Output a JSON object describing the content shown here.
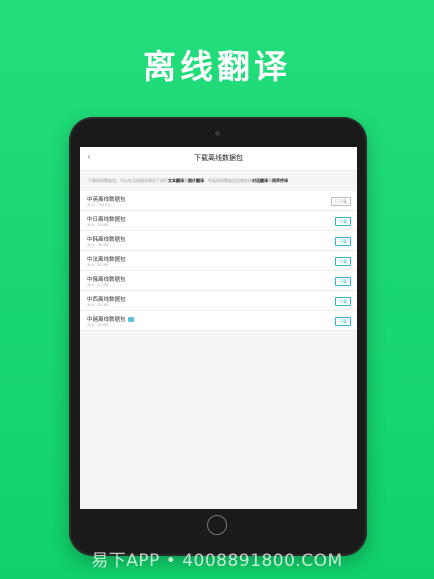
{
  "headline": "离线翻译",
  "screen": {
    "nav_title": "下载离线数据包",
    "notice": {
      "p1": "下载离线数据包，可以在无网络的情况下进行",
      "b1": "文本翻译",
      "p2": "和",
      "b2": "图片翻译",
      "p3": "，中英离线数据包还增支持",
      "b3": "对话翻译",
      "p4": "和",
      "b4": "同声传译"
    },
    "packages": [
      {
        "name": "中英离线数据包",
        "size": "大小：704.1G",
        "button": "已下载",
        "done": true
      },
      {
        "name": "中日离线数据包",
        "size": "大小：44.0M",
        "button": "下载",
        "done": false
      },
      {
        "name": "中韩离线数据包",
        "size": "大小：38.0M",
        "button": "下载",
        "done": false
      },
      {
        "name": "中法离线数据包",
        "size": "大小：42.9M",
        "button": "下载",
        "done": false
      },
      {
        "name": "中俄离线数据包",
        "size": "大小：27.5M",
        "button": "下载",
        "done": false
      },
      {
        "name": "中西离线数据包",
        "size": "大小：43.4M",
        "button": "下载",
        "done": false
      },
      {
        "name": "中越离线数据包",
        "size": "大小：42.8M",
        "button": "下载",
        "done": false
      }
    ]
  },
  "footer": "易下APP • 4008891800.COM",
  "colors": {
    "background": "#1ad872",
    "accent": "#31b5c7"
  }
}
